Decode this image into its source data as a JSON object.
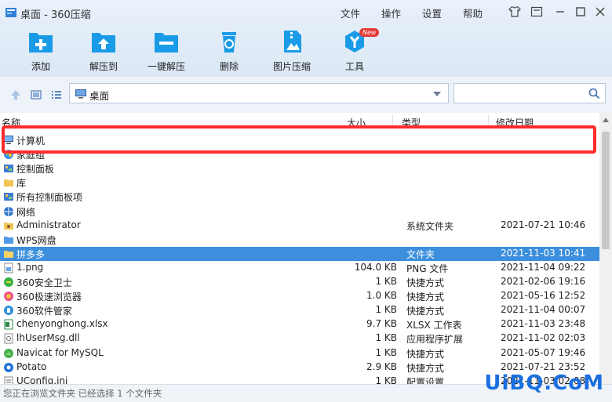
{
  "window": {
    "title": "桌面 - 360压缩"
  },
  "menu": [
    "文件",
    "操作",
    "设置",
    "帮助"
  ],
  "toolbar": {
    "add": "添加",
    "extract_to": "解压到",
    "one_click_extract": "一键解压",
    "delete": "删除",
    "image_compress": "图片压缩",
    "tools": "工具",
    "tools_badge": "New"
  },
  "address": {
    "path": "桌面"
  },
  "search": {
    "placeholder": ""
  },
  "columns": {
    "name": "名称",
    "size": "大小",
    "type": "类型",
    "date": "修改日期"
  },
  "files": [
    {
      "name": "计算机",
      "size": "",
      "type": "",
      "date": "",
      "icon": "computer-icon"
    },
    {
      "name": "家庭组",
      "size": "",
      "type": "",
      "date": "",
      "icon": "homegroup-icon"
    },
    {
      "name": "控制面板",
      "size": "",
      "type": "",
      "date": "",
      "icon": "control-panel-icon"
    },
    {
      "name": "库",
      "size": "",
      "type": "",
      "date": "",
      "icon": "library-icon"
    },
    {
      "name": "所有控制面板项",
      "size": "",
      "type": "",
      "date": "",
      "icon": "control-panel-icon"
    },
    {
      "name": "网络",
      "size": "",
      "type": "",
      "date": "",
      "icon": "network-icon"
    },
    {
      "name": "Administrator",
      "size": "",
      "type": "系统文件夹",
      "date": "2021-07-21 10:46",
      "icon": "user-folder-icon"
    },
    {
      "name": "WPS网盘",
      "size": "",
      "type": "",
      "date": "",
      "icon": "cloud-folder-icon"
    },
    {
      "name": "拼多多",
      "size": "",
      "type": "文件夹",
      "date": "2021-11-03 10:41",
      "icon": "folder-icon"
    },
    {
      "name": "1.png",
      "size": "104.0 KB",
      "type": "PNG 文件",
      "date": "2021-11-04 09:22",
      "icon": "image-file-icon"
    },
    {
      "name": "360安全卫士",
      "size": "1 KB",
      "type": "快捷方式",
      "date": "2021-02-06 19:16",
      "icon": "360-security-icon"
    },
    {
      "name": "360极速浏览器",
      "size": "1.0 KB",
      "type": "快捷方式",
      "date": "2021-05-16 12:52",
      "icon": "360-browser-icon"
    },
    {
      "name": "360软件管家",
      "size": "1 KB",
      "type": "快捷方式",
      "date": "2021-11-04 00:07",
      "icon": "360-software-icon"
    },
    {
      "name": "chenyonghong.xlsx",
      "size": "9.7 KB",
      "type": "XLSX 工作表",
      "date": "2021-11-03 23:48",
      "icon": "excel-file-icon"
    },
    {
      "name": "lhUserMsg.dll",
      "size": "1 KB",
      "type": "应用程序扩展",
      "date": "2021-11-02 02:03",
      "icon": "dll-file-icon"
    },
    {
      "name": "Navicat for MySQL",
      "size": "1 KB",
      "type": "快捷方式",
      "date": "2021-05-07 19:46",
      "icon": "navicat-icon"
    },
    {
      "name": "Potato",
      "size": "2.9 KB",
      "type": "快捷方式",
      "date": "2021-07-21 23:52",
      "icon": "potato-icon"
    },
    {
      "name": "UConfig.ini",
      "size": "1 KB",
      "type": "配置设置",
      "date": "2021-11-03 02:08",
      "icon": "ini-file-icon"
    }
  ],
  "status": {
    "text": "您正在浏览文件夹 已经选择 1 个文件夹"
  },
  "watermark": "UiBQ.CoM",
  "colors": {
    "selection": "#3c8fdc",
    "highlight_border": "#ff2b2b",
    "accent": "#1a9be8"
  }
}
